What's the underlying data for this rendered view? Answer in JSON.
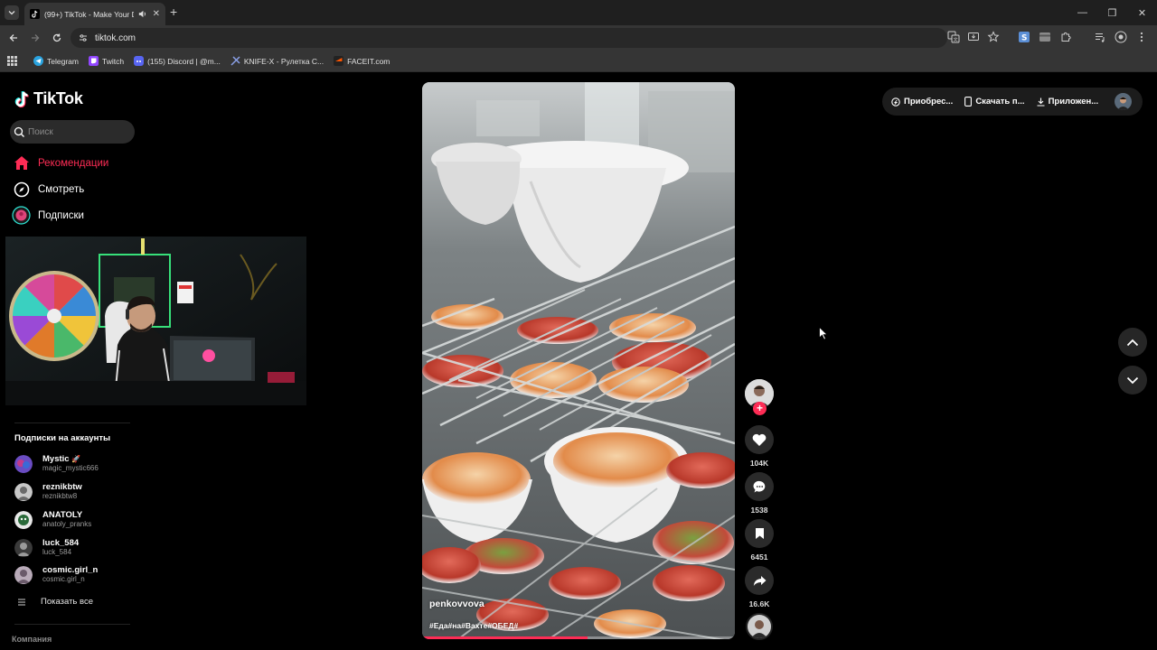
{
  "browser": {
    "tab_title": "(99+) TikTok - Make Your Day",
    "url": "tiktok.com",
    "bookmarks": [
      {
        "label": "Telegram",
        "color": "#2aa3df"
      },
      {
        "label": "Twitch",
        "color": "#9146ff"
      },
      {
        "label": "(155) Discord | @m...",
        "color": "#5865f2"
      },
      {
        "label": "KNIFE-X - Рулетка C...",
        "color": "#6c7bd8"
      },
      {
        "label": "FACEIT.com",
        "color": "#ff5500"
      }
    ]
  },
  "sidebar": {
    "logo": "TikTok",
    "search_placeholder": "Поиск",
    "nav": [
      {
        "label": "Рекомендации",
        "icon": "home-icon",
        "active": true
      },
      {
        "label": "Смотреть",
        "icon": "compass-icon",
        "active": false
      },
      {
        "label": "Подписки",
        "icon": "following-icon",
        "active": false
      }
    ],
    "following_title": "Подписки на аккаунты",
    "accounts": [
      {
        "name": "Mystic",
        "handle": "magic_mystic666",
        "color": "#6a4cc2"
      },
      {
        "name": "reznikbtw",
        "handle": "reznikbtw8",
        "color": "#8c8c8c"
      },
      {
        "name": "ANATOLY",
        "handle": "anatoly_pranks",
        "color": "#4f7a4f"
      },
      {
        "name": "luck_584",
        "handle": "luck_584",
        "color": "#5a5a5a"
      },
      {
        "name": "cosmic.girl_n",
        "handle": "cosmic.girl_n",
        "color": "#9a8aa0"
      }
    ],
    "show_all": "Показать все",
    "company": "Компания"
  },
  "video": {
    "author": "penkovvova",
    "hashtags": "#Еда#на#Вахте#ОБЕД#",
    "progress": 0.53
  },
  "actions": {
    "likes": "104K",
    "comments": "1538",
    "saves": "6451",
    "shares": "16.6K"
  },
  "topbar": {
    "buy": "Приобрес...",
    "download": "Скачать п...",
    "app": "Приложен..."
  },
  "colors": {
    "accent": "#fe2c55",
    "background": "#000000"
  }
}
